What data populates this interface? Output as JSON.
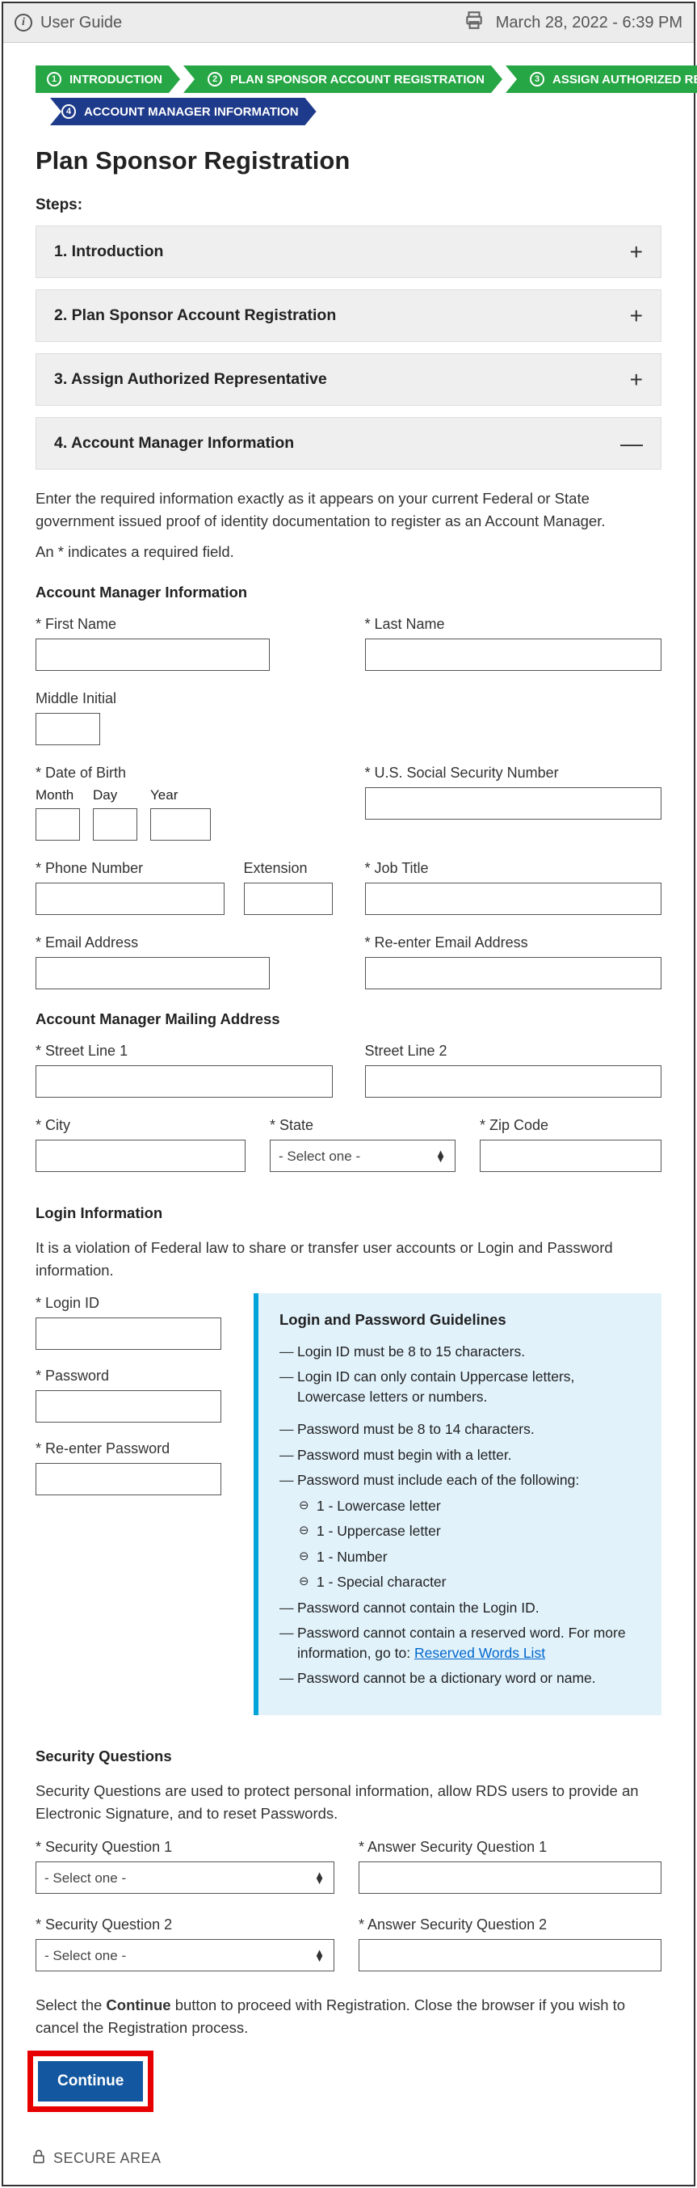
{
  "topbar": {
    "user_guide": "User Guide",
    "timestamp": "March 28, 2022 - 6:39 PM"
  },
  "wizard": {
    "step1": "INTRODUCTION",
    "step2": "PLAN SPONSOR ACCOUNT REGISTRATION",
    "step3": "ASSIGN AUTHORIZED REPRESENTATIVE",
    "step4": "ACCOUNT MANAGER INFORMATION"
  },
  "page_title": "Plan Sponsor Registration",
  "steps_label": "Steps:",
  "accordion": {
    "s1": "1. Introduction",
    "s2": "2. Plan Sponsor Account Registration",
    "s3": "3. Assign Authorized Representative",
    "s4": "4. Account Manager Information"
  },
  "intro_text": "Enter the required information exactly as it appears on your current Federal or State government issued proof of identity documentation to register as an Account Manager.",
  "required_hint": "An * indicates a required field.",
  "sections": {
    "ami": "Account Manager Information",
    "mail": "Account Manager Mailing Address",
    "login": "Login Information",
    "sq": "Security Questions"
  },
  "labels": {
    "first_name": "First Name",
    "last_name": "Last Name",
    "middle_initial": "Middle Initial",
    "dob": "Date of Birth",
    "month": "Month",
    "day": "Day",
    "year": "Year",
    "ssn": "U.S. Social Security Number",
    "phone": "Phone Number",
    "ext": "Extension",
    "job": "Job Title",
    "email": "Email Address",
    "remail": "Re-enter Email Address",
    "street1": "Street Line 1",
    "street2": "Street Line 2",
    "city": "City",
    "state": "State",
    "zip": "Zip Code",
    "login_id": "Login ID",
    "password": "Password",
    "repassword": "Re-enter Password",
    "sq1": "Security Question 1",
    "sqa1": "Answer Security Question 1",
    "sq2": "Security Question 2",
    "sqa2": "Answer Security Question 2"
  },
  "select_placeholder": "- Select one -",
  "login_violation": "It is a violation of Federal law to share or transfer user accounts or Login and Password information.",
  "guidelines": {
    "title": "Login and Password Guidelines",
    "g1": "Login ID must be 8 to 15 characters.",
    "g2": "Login ID can only contain Uppercase letters, Lowercase letters or numbers.",
    "g3": "Password must be 8 to 14 characters.",
    "g4": "Password must begin with a letter.",
    "g5": "Password must include each of the following:",
    "g5a": "1 - Lowercase letter",
    "g5b": "1 - Uppercase letter",
    "g5c": "1 - Number",
    "g5d": "1 - Special character",
    "g6": "Password cannot contain the Login ID.",
    "g7a": "Password cannot contain a reserved word. For more information, go to: ",
    "g7b": "Reserved Words List",
    "g8": "Password cannot be a dictionary word or name."
  },
  "sq_desc": "Security Questions are used to protect personal information, allow RDS users to provide an Electronic Signature, and to reset Passwords.",
  "continue_hint_a": "Select the ",
  "continue_hint_b": "Continue",
  "continue_hint_c": " button to proceed with Registration. Close the browser if you wish to cancel the Registration process.",
  "continue_btn": "Continue",
  "secure": "SECURE AREA"
}
